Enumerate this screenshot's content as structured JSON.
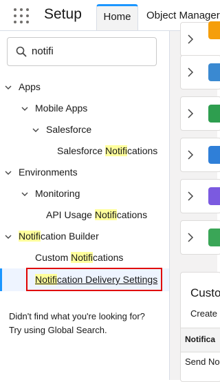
{
  "header": {
    "app_name": "Setup",
    "tabs": [
      {
        "label": "Home",
        "active": true
      },
      {
        "label": "Object Manager",
        "active": false
      }
    ]
  },
  "search": {
    "value": "notifi"
  },
  "tree": {
    "apps": {
      "label": "Apps",
      "mobile_apps": {
        "label": "Mobile Apps",
        "salesforce": {
          "label": "Salesforce",
          "sf_notifications": {
            "before": "Salesforce ",
            "match": "Notifi",
            "after": "cations"
          }
        }
      }
    },
    "environments": {
      "label": "Environments",
      "monitoring": {
        "label": "Monitoring",
        "api_usage": {
          "before": "API Usage ",
          "match": "Notifi",
          "after": "cations"
        }
      }
    },
    "notification_builder": {
      "label": {
        "before": "",
        "match": "Notifi",
        "after": "cation Builder"
      },
      "custom_notifications": {
        "before": "Custom ",
        "match": "Notifi",
        "after": "cations"
      },
      "delivery_settings": {
        "before": "",
        "match": "Notifi",
        "after": "cation Delivery Settings"
      }
    }
  },
  "help": {
    "line1": "Didn't find what you're looking for?",
    "line2": "Try using Global Search."
  },
  "right_panel": {
    "cards": [
      {
        "icon": "arrows-icon",
        "color": "#f59e0b"
      },
      {
        "icon": "chart-icon",
        "color": "#3a89d1"
      },
      {
        "icon": "list-icon",
        "color": "#2e9e4f"
      },
      {
        "icon": "pulse-icon",
        "color": "#2f7fd8"
      },
      {
        "icon": "form-icon",
        "color": "#7b5ae0"
      },
      {
        "icon": "trend-icon",
        "color": "#3aa657"
      }
    ],
    "title": "Custo",
    "create": "Create",
    "column_header": "Notifica",
    "row": "Send No"
  },
  "colors": {
    "highlight": "#ffff9c",
    "accent": "#1b96ff",
    "callout": "#e00000"
  }
}
